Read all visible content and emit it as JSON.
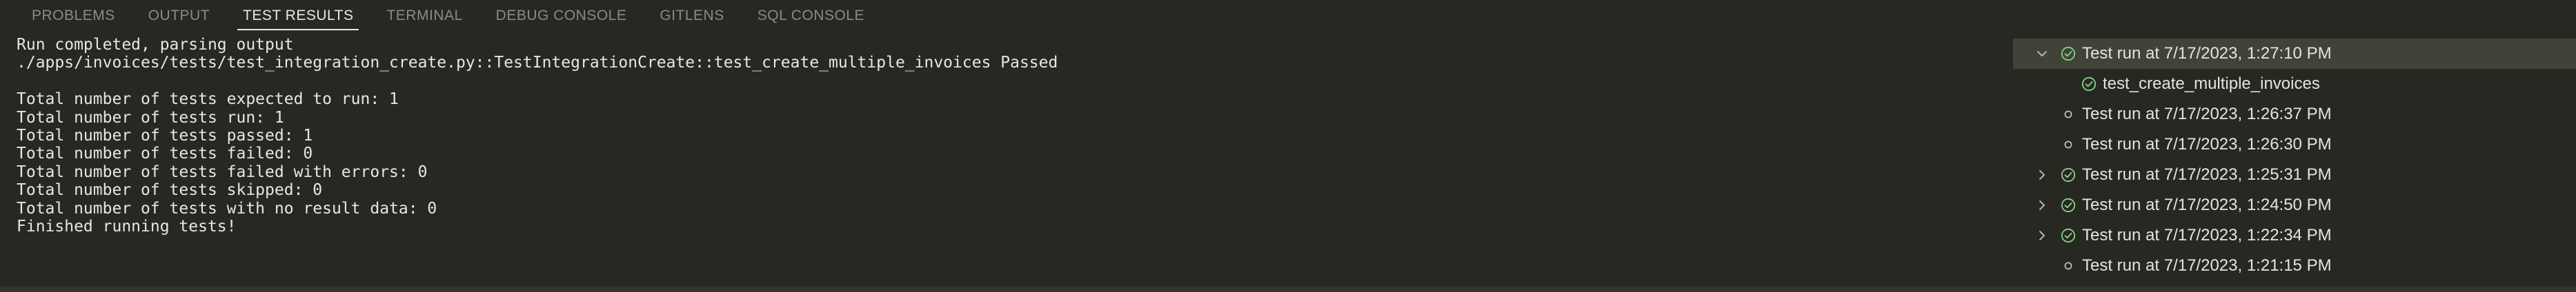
{
  "tabs": [
    {
      "label": "PROBLEMS",
      "active": false
    },
    {
      "label": "OUTPUT",
      "active": false
    },
    {
      "label": "TEST RESULTS",
      "active": true
    },
    {
      "label": "TERMINAL",
      "active": false
    },
    {
      "label": "DEBUG CONSOLE",
      "active": false
    },
    {
      "label": "GITLENS",
      "active": false
    },
    {
      "label": "SQL CONSOLE",
      "active": false
    }
  ],
  "console_lines": [
    "Run completed, parsing output",
    "./apps/invoices/tests/test_integration_create.py::TestIntegrationCreate::test_create_multiple_invoices Passed",
    "",
    "Total number of tests expected to run: 1",
    "Total number of tests run: 1",
    "Total number of tests passed: 1",
    "Total number of tests failed: 0",
    "Total number of tests failed with errors: 0",
    "Total number of tests skipped: 0",
    "Total number of tests with no result data: 0",
    "Finished running tests!"
  ],
  "test_runs": [
    {
      "label": "Test run at 7/17/2023, 1:27:10 PM",
      "status": "passed",
      "twistie": "expanded",
      "selected": true,
      "level": 0
    },
    {
      "label": "test_create_multiple_invoices",
      "status": "passed",
      "twistie": "none",
      "selected": false,
      "level": 1
    },
    {
      "label": "Test run at 7/17/2023, 1:26:37 PM",
      "status": "none",
      "twistie": "none",
      "selected": false,
      "level": 0
    },
    {
      "label": "Test run at 7/17/2023, 1:26:30 PM",
      "status": "none",
      "twistie": "none",
      "selected": false,
      "level": 0
    },
    {
      "label": "Test run at 7/17/2023, 1:25:31 PM",
      "status": "passed",
      "twistie": "collapsed",
      "selected": false,
      "level": 0
    },
    {
      "label": "Test run at 7/17/2023, 1:24:50 PM",
      "status": "passed",
      "twistie": "collapsed",
      "selected": false,
      "level": 0
    },
    {
      "label": "Test run at 7/17/2023, 1:22:34 PM",
      "status": "passed",
      "twistie": "collapsed",
      "selected": false,
      "level": 0
    },
    {
      "label": "Test run at 7/17/2023, 1:21:15 PM",
      "status": "none",
      "twistie": "none",
      "selected": false,
      "level": 0
    }
  ],
  "icons": {
    "passed": "check-circle-icon",
    "none": "circle-outline-icon",
    "expanded": "chevron-down-icon",
    "collapsed": "chevron-right-icon"
  },
  "colors": {
    "background": "#272822",
    "passed": "#89d185",
    "selected_row": "#414339",
    "muted": "#8a8a86"
  }
}
